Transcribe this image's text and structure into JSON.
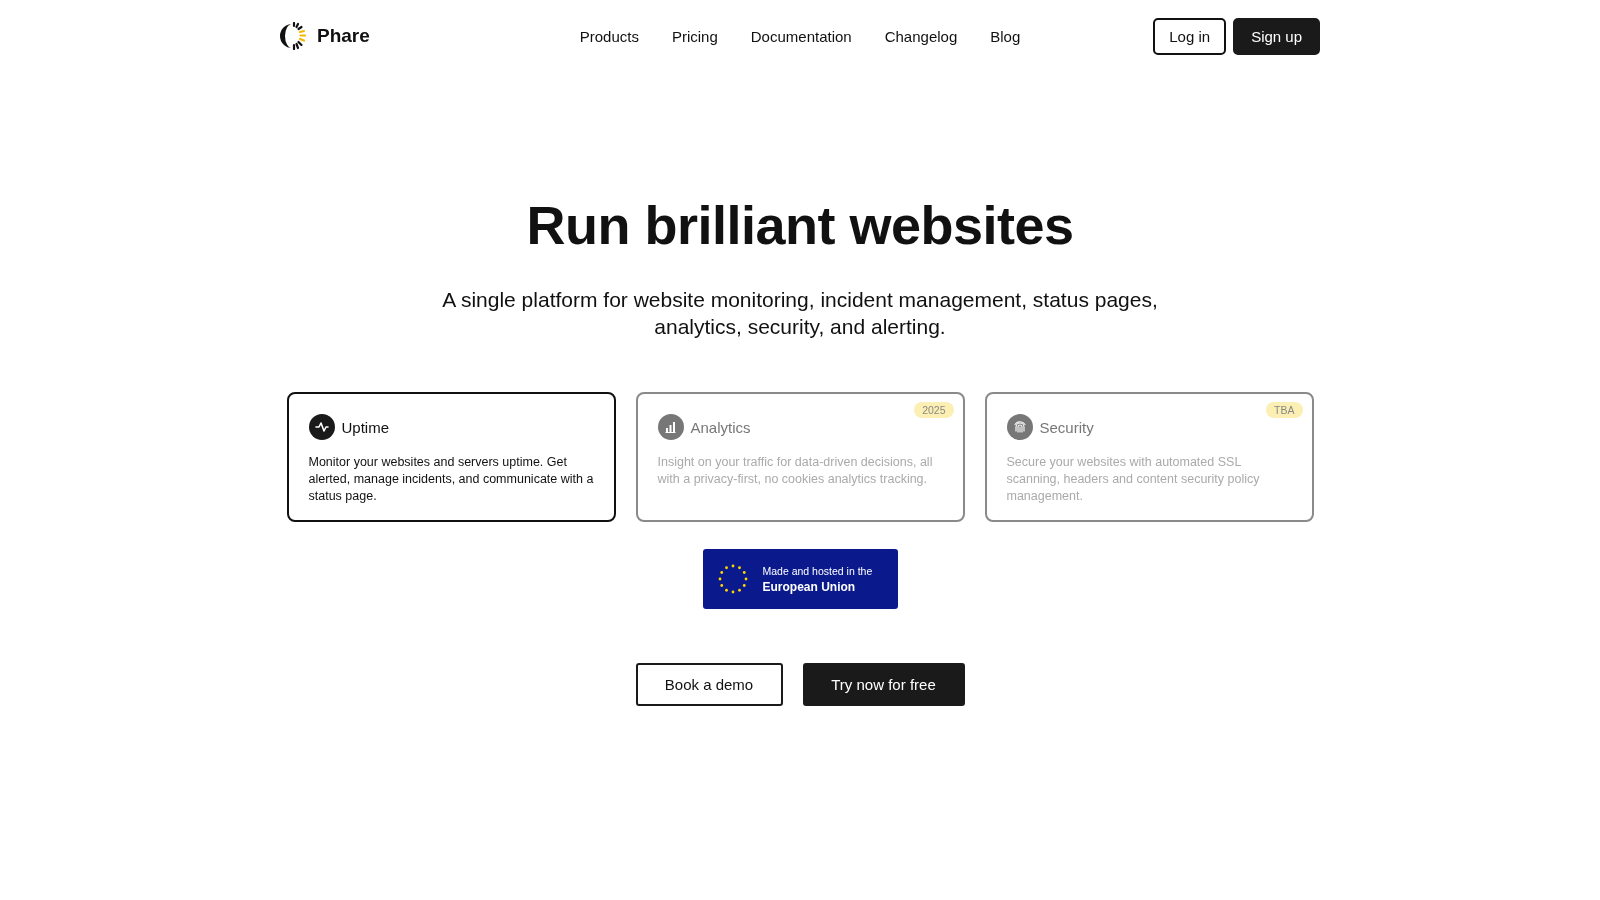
{
  "brand": {
    "name": "Phare"
  },
  "nav": {
    "links": [
      "Products",
      "Pricing",
      "Documentation",
      "Changelog",
      "Blog"
    ],
    "login": "Log in",
    "signup": "Sign up"
  },
  "hero": {
    "title": "Run brilliant websites",
    "subtitle": "A single platform for website monitoring, incident management, status pages, analytics, security, and alerting."
  },
  "products": [
    {
      "name": "Uptime",
      "description": "Monitor your websites and servers uptime. Get alerted, manage incidents, and communicate with a status page.",
      "selected": true
    },
    {
      "name": "Analytics",
      "description": "Insight on your traffic for data-driven decisions, all with a privacy-first, no cookies analytics tracking.",
      "selected": false,
      "badge": "2025"
    },
    {
      "name": "Security",
      "description": "Secure your websites with automated SSL scanning, headers and content security policy management.",
      "selected": false,
      "badge": "TBA"
    }
  ],
  "eu_badge": {
    "line_1": "Made and hosted in the",
    "line_2": "European Union"
  },
  "actions": {
    "secondary": "Book a demo",
    "primary": "Try now for free"
  }
}
